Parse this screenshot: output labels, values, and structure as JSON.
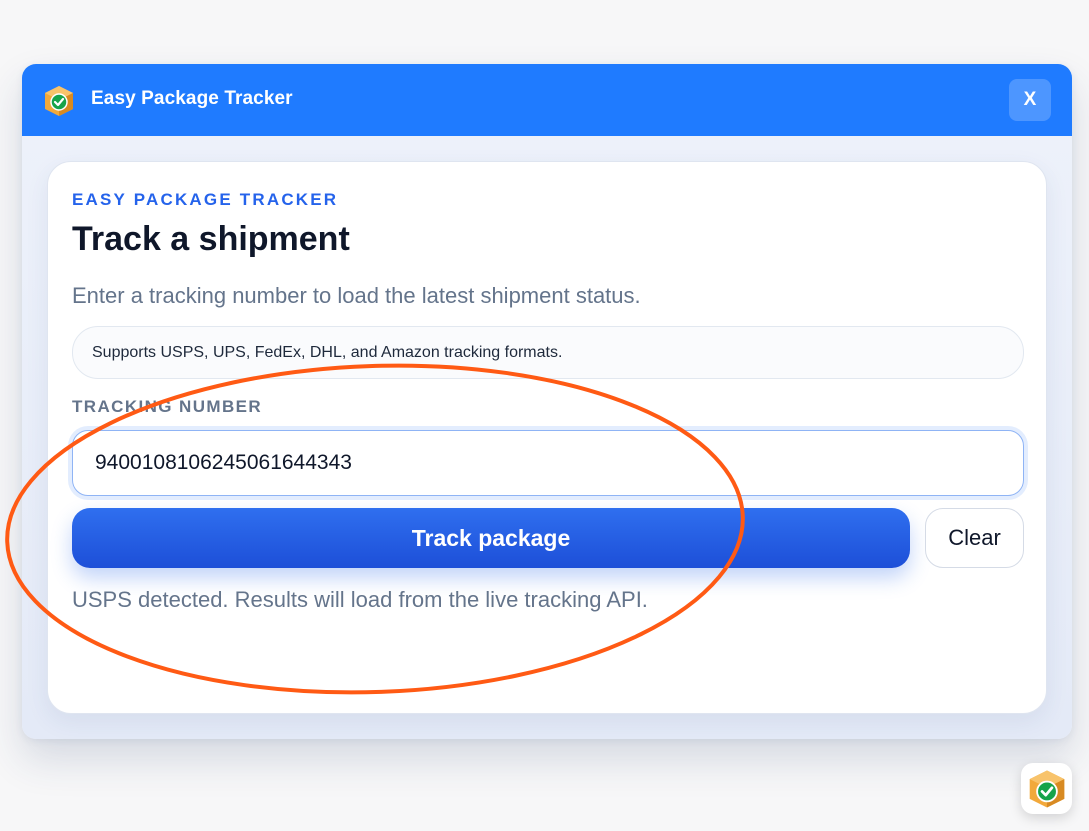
{
  "window": {
    "title": "Easy Package Tracker",
    "close_label": "X"
  },
  "card": {
    "eyebrow": "EASY PACKAGE TRACKER",
    "heading": "Track a shipment",
    "subtitle": "Enter a tracking number to load the latest shipment status.",
    "notice": "Supports USPS, UPS, FedEx, DHL, and Amazon tracking formats.",
    "field_label": "TRACKING NUMBER",
    "tracking_value": "9400108106245061644343",
    "track_button": "Track package",
    "clear_button": "Clear",
    "status": "USPS detected. Results will load from the live tracking API."
  },
  "colors": {
    "titlebar": "#1f7bff",
    "accent": "#2563eb",
    "annotation": "#ff5a14",
    "icon_box": "#f2a93b",
    "icon_check": "#16a34a"
  },
  "icons": {
    "app": "package-check-icon",
    "dock": "package-check-icon"
  }
}
